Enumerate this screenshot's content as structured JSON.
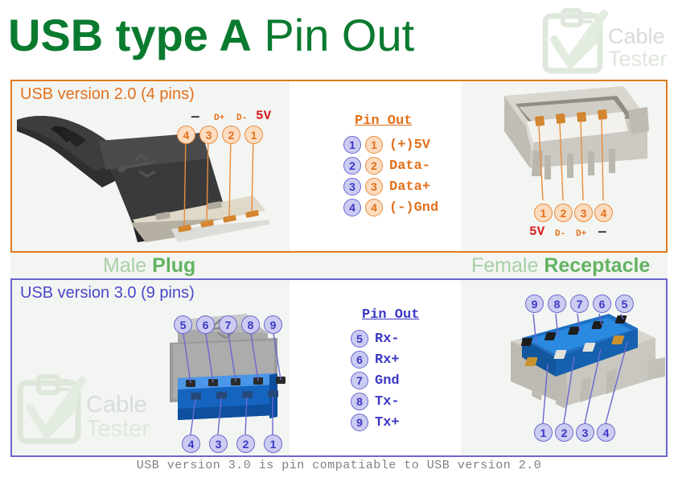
{
  "header": {
    "title_bold": "USB type A",
    "title_light": " Pin Out",
    "logo_line1": "Cable",
    "logo_line2": "Tester",
    "logo_name": "cable-tester-logo"
  },
  "colors": {
    "title_green": "#0a7a2f",
    "usb2_orange": "#e2711d",
    "usb2_border": "#e07b1e",
    "usb3_blue": "#4a47c8",
    "usb3_border": "#6a67d0",
    "label_green_light": "#a8d0a8",
    "label_green_bold": "#63b363",
    "footer_gray": "#808080",
    "red_5v": "#d81f1f"
  },
  "usb2": {
    "heading": "USB version 2.0 (4 pins)",
    "pinout_title": "Pin Out",
    "rows": [
      {
        "num": "1",
        "label": "(+)5V"
      },
      {
        "num": "2",
        "label": "Data-"
      },
      {
        "num": "3",
        "label": "Data+"
      },
      {
        "num": "4",
        "label": "(-)Gnd"
      }
    ],
    "plug_callouts": [
      "4",
      "3",
      "2",
      "1"
    ],
    "plug_signals": [
      "—",
      "D+",
      "D-",
      "5V"
    ],
    "receptacle_callouts": [
      "1",
      "2",
      "3",
      "4"
    ],
    "receptacle_signals": [
      "5V",
      "D-",
      "D+",
      "—"
    ]
  },
  "usb3": {
    "heading": "USB version 3.0 (9 pins)",
    "pinout_title": "Pin Out",
    "rows": [
      {
        "num": "5",
        "label": "Rx-"
      },
      {
        "num": "6",
        "label": "Rx+"
      },
      {
        "num": "7",
        "label": "Gnd"
      },
      {
        "num": "8",
        "label": "Tx-"
      },
      {
        "num": "9",
        "label": "Tx+"
      }
    ],
    "plug_top_callouts": [
      "5",
      "6",
      "7",
      "8",
      "9"
    ],
    "plug_bottom_callouts": [
      "4",
      "3",
      "2",
      "1"
    ],
    "receptacle_top_callouts": [
      "9",
      "8",
      "7",
      "6",
      "5"
    ],
    "receptacle_bottom_callouts": [
      "1",
      "2",
      "3",
      "4"
    ]
  },
  "labels": {
    "male_light": "Male ",
    "male_bold": "Plug",
    "female_light": "Female ",
    "female_bold": "Receptacle"
  },
  "footer": {
    "note": "USB version 3.0 is pin compatiable to USB version 2.0"
  },
  "watermark": {
    "line1": "Cable",
    "line2": "Tester"
  }
}
